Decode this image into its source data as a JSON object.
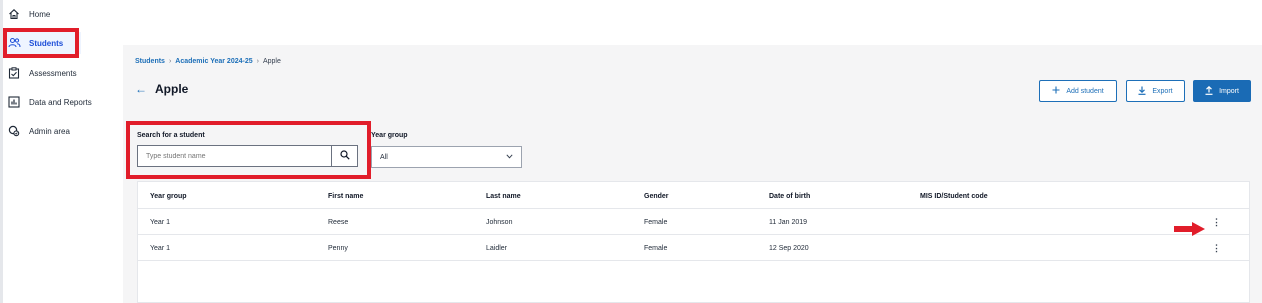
{
  "sidebar": {
    "items": [
      {
        "label": "Home",
        "icon": "home-icon"
      },
      {
        "label": "Students",
        "icon": "users-icon",
        "active": true
      },
      {
        "label": "Assessments",
        "icon": "clipboard-icon"
      },
      {
        "label": "Data and Reports",
        "icon": "chart-icon"
      },
      {
        "label": "Admin area",
        "icon": "admin-icon"
      }
    ]
  },
  "breadcrumb": {
    "items": [
      "Students",
      "Academic Year 2024-25",
      "Apple"
    ],
    "separator": "›"
  },
  "page": {
    "back_glyph": "←",
    "title": "Apple"
  },
  "toolbar": {
    "add_student_label": "Add student",
    "export_label": "Export",
    "import_label": "Import"
  },
  "search": {
    "label": "Search for a student",
    "placeholder": "Type student name"
  },
  "filters": {
    "year_group_label": "Year group",
    "year_group_value": "All"
  },
  "table": {
    "columns": [
      "Year group",
      "First name",
      "Last name",
      "Gender",
      "Date of birth",
      "MIS ID/Student code"
    ],
    "rows": [
      [
        "Year 1",
        "Reese",
        "Johnson",
        "Female",
        "11 Jan 2019",
        ""
      ],
      [
        "Year 1",
        "Penny",
        "Laidler",
        "Female",
        "12 Sep 2020",
        ""
      ]
    ],
    "row_menu_glyph": "⋮"
  },
  "colors": {
    "accent": "#1a6bb5",
    "highlight": "#e11d2a",
    "annotation_arrow": "#e11d2a"
  }
}
